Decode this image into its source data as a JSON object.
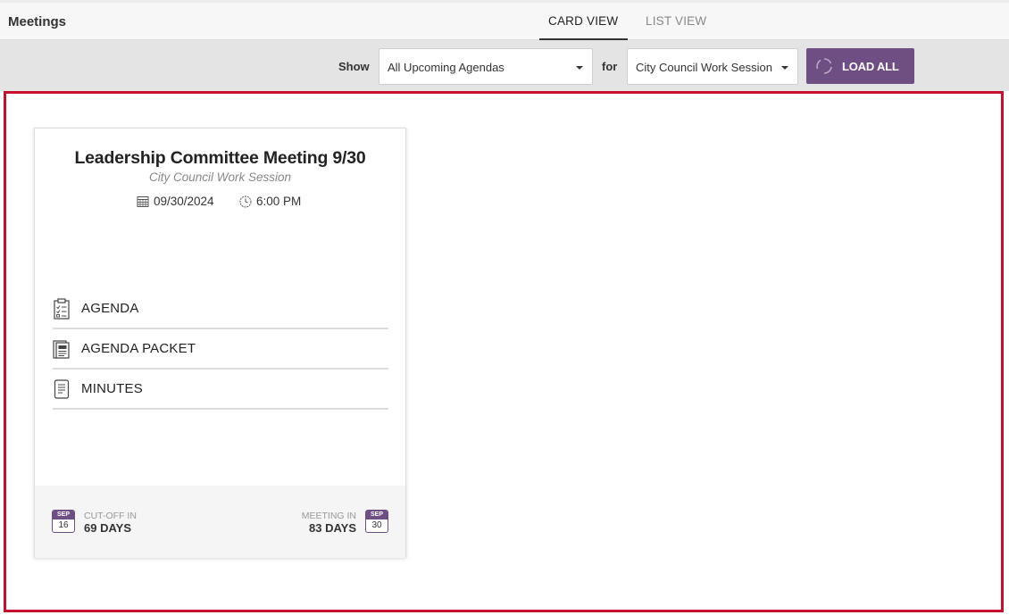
{
  "header": {
    "title": "Meetings",
    "tabs": [
      {
        "label": "CARD VIEW",
        "active": true
      },
      {
        "label": "LIST VIEW",
        "active": false
      }
    ]
  },
  "filters": {
    "show_label": "Show",
    "show_value": "All Upcoming Agendas",
    "for_label": "for",
    "for_value": "City Council Work Session",
    "load_all_label": "LOAD ALL"
  },
  "colors": {
    "accent": "#6f4e84",
    "frame": "#c8102e"
  },
  "card": {
    "title": "Leadership Committee Meeting 9/30",
    "subtitle": "City Council Work Session",
    "date": "09/30/2024",
    "time": "6:00 PM",
    "links": [
      {
        "label": "AGENDA",
        "icon": "clipboard-checklist-icon"
      },
      {
        "label": "AGENDA PACKET",
        "icon": "document-stack-icon"
      },
      {
        "label": "MINUTES",
        "icon": "document-lines-icon"
      }
    ],
    "footer": {
      "cutoff": {
        "caption": "CUT-OFF IN",
        "value": "69 DAYS",
        "month": "SEP",
        "day": "16"
      },
      "meeting": {
        "caption": "MEETING IN",
        "value": "83 DAYS",
        "month": "SEP",
        "day": "30"
      }
    }
  }
}
